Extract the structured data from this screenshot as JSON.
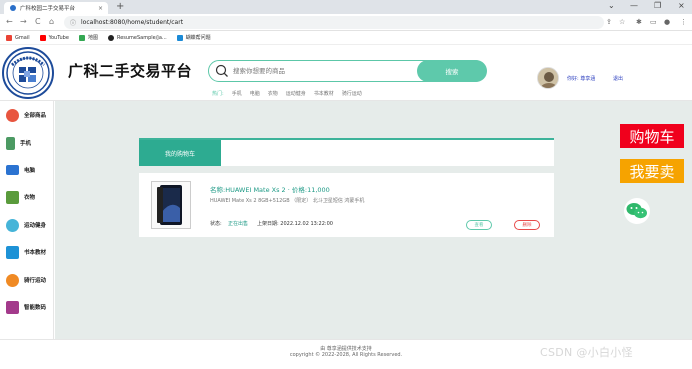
{
  "browser": {
    "tab_title": "广科校园二手交易平台",
    "tab_close": "×",
    "new_tab": "+",
    "url": "localhost:8080/home/student/cart",
    "back": "←",
    "forward": "→",
    "reload": "C",
    "home": "⌂",
    "info_icon": "ⓘ",
    "window_controls": [
      "⌄",
      "—",
      "❐",
      "×"
    ],
    "toolbar_icons": [
      "⇪",
      "☆",
      "✱",
      "▭",
      "●",
      "⋮"
    ]
  },
  "bookmarks": [
    {
      "label": "Gmail",
      "color": "#ea4335"
    },
    {
      "label": "YouTube",
      "color": "#ff0000"
    },
    {
      "label": "地图",
      "color": "#34a853"
    },
    {
      "label": "ResumeSample/ja...",
      "color": "#222222"
    },
    {
      "label": "蝴蝶帮问题",
      "color": "#1b8ad6"
    }
  ],
  "header": {
    "site_name": "广科二手交易平台",
    "search_placeholder": "搜索你想要的商品",
    "search_button": "搜索",
    "hot_label": "热门:",
    "hot_items": [
      "手机",
      "电脑",
      "衣物",
      "运动健身",
      "书本教材",
      "骑行运动"
    ],
    "greeting": "你好: 尊享涵",
    "logout": "退出"
  },
  "sidebar": {
    "items": [
      {
        "label": "全部商品",
        "icon": "all-goods-icon",
        "color": "#e8553f"
      },
      {
        "label": "手机",
        "icon": "phone-icon",
        "color": "#4c9a63"
      },
      {
        "label": "电脑",
        "icon": "computer-icon",
        "color": "#2b73d1"
      },
      {
        "label": "衣物",
        "icon": "clothes-icon",
        "color": "#5a9b3c"
      },
      {
        "label": "运动健身",
        "icon": "sports-icon",
        "color": "#46b4d8"
      },
      {
        "label": "书本教材",
        "icon": "book-icon",
        "color": "#1d92d6"
      },
      {
        "label": "骑行运动",
        "icon": "bike-icon",
        "color": "#f08a24"
      },
      {
        "label": "智能数码",
        "icon": "digital-icon",
        "color": "#a33a8b"
      }
    ]
  },
  "main": {
    "tab_active": "我的购物车",
    "cart_items": [
      {
        "name": "名称:HUAWEI Mate Xs 2 · 价格:11,000",
        "desc": "HUAWEI Mate Xs 2 8GB+512GB （限定） 北斗卫星短信 鸿蒙手机",
        "status_label": "状态:",
        "status": "正在出售",
        "date": "上架日期: 2022.12.02 13:22:00",
        "detail_btn": "查看",
        "delete_btn": "删除"
      }
    ]
  },
  "floating": {
    "cart": "购物车",
    "sell": "我要卖"
  },
  "footer": {
    "line1": "由 尊享涵提供技术支持",
    "line2": "copyright © 2022-2028, All Rights Reserved."
  },
  "watermark": "CSDN @小白小怪"
}
